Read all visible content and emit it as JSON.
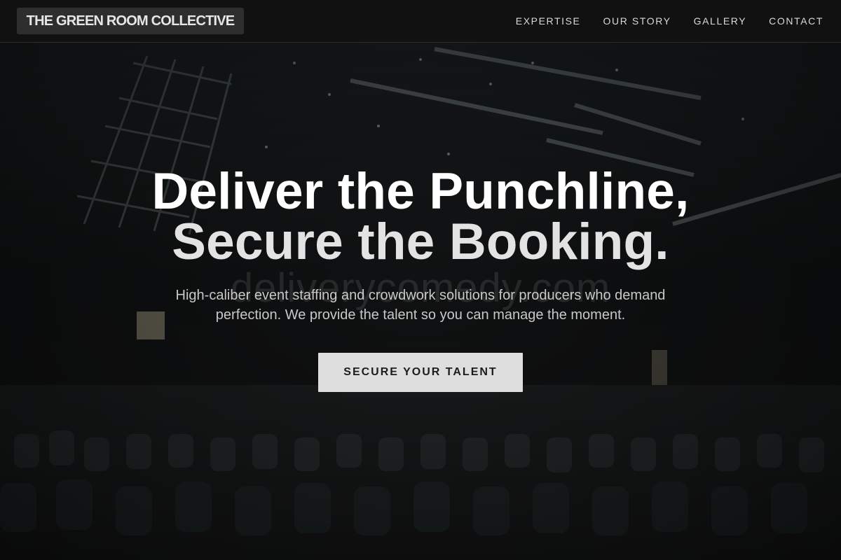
{
  "brand": {
    "name": "THE GREEN ROOM COLLECTIVE"
  },
  "nav": {
    "items": [
      {
        "label": "EXPERTISE"
      },
      {
        "label": "OUR STORY"
      },
      {
        "label": "GALLERY"
      },
      {
        "label": "CONTACT"
      }
    ]
  },
  "hero": {
    "headline_line1": "Deliver the Punchline,",
    "headline_line2": "Secure the Booking.",
    "watermark": "deliverycomedy.com",
    "subtitle": "High-caliber event staffing and crowdwork solutions for producers who demand perfection. We provide the talent so you can manage the moment.",
    "cta_label": "SECURE YOUR TALENT",
    "background_image": "dark-banquet-hall-photo"
  },
  "colors": {
    "page_bg": "#141414",
    "navbar_bg": "#111111",
    "logo_bg": "#2e2e2e",
    "cta_bg": "#dedede",
    "cta_text": "#1c1c1c"
  }
}
